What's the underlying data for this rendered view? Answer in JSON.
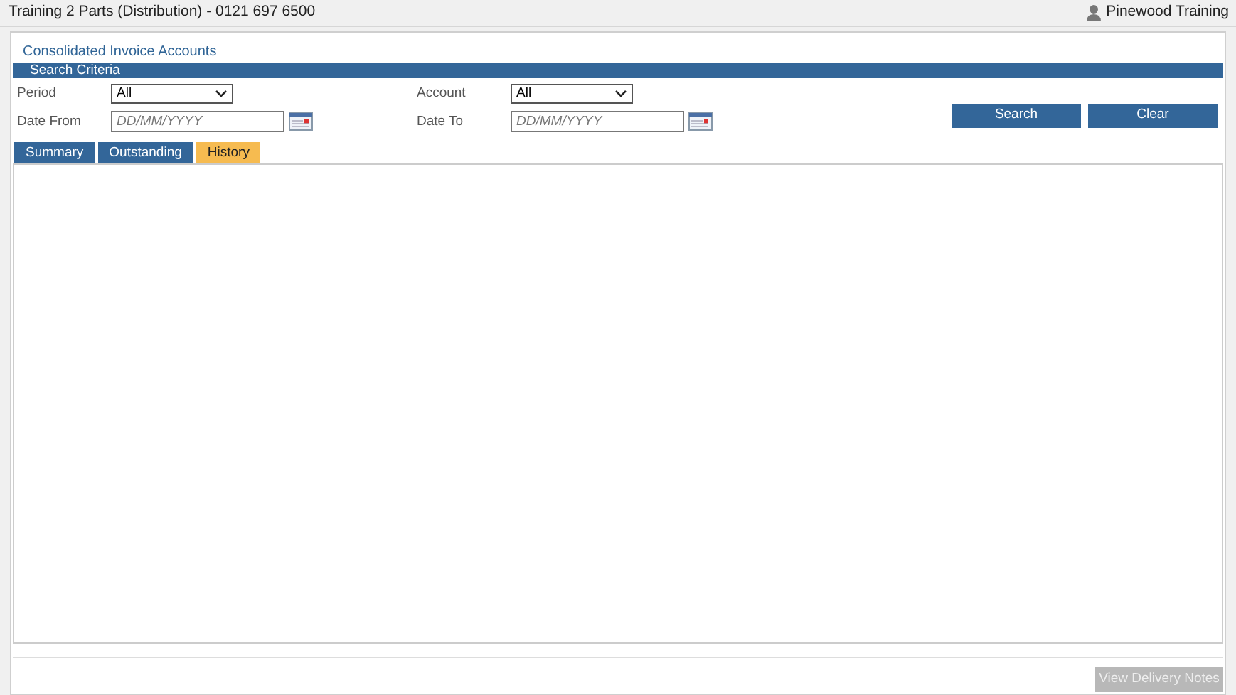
{
  "window": {
    "title": "Training 2 Parts (Distribution) - 0121 697 6500",
    "user": "Pinewood Training"
  },
  "page_title": "Consolidated Invoice Accounts",
  "search_criteria": {
    "heading": "Search Criteria",
    "fields": [
      {
        "kind": "select",
        "label": "Period",
        "value": "All"
      },
      {
        "kind": "select",
        "label": "Account",
        "value": "All"
      },
      {
        "kind": "date",
        "label": "Date From",
        "placeholder": "DD/MM/YYYY"
      },
      {
        "kind": "date",
        "label": "Date To",
        "placeholder": "DD/MM/YYYY"
      }
    ],
    "buttons": [
      {
        "label": "Search"
      },
      {
        "label": "Clear"
      }
    ]
  },
  "tabs": [
    {
      "label": "Summary",
      "selected": false
    },
    {
      "label": "Outstanding",
      "selected": false
    },
    {
      "label": "History",
      "selected": true
    }
  ],
  "footer_buttons": [
    {
      "label": "View Delivery Notes",
      "disabled": true
    }
  ]
}
